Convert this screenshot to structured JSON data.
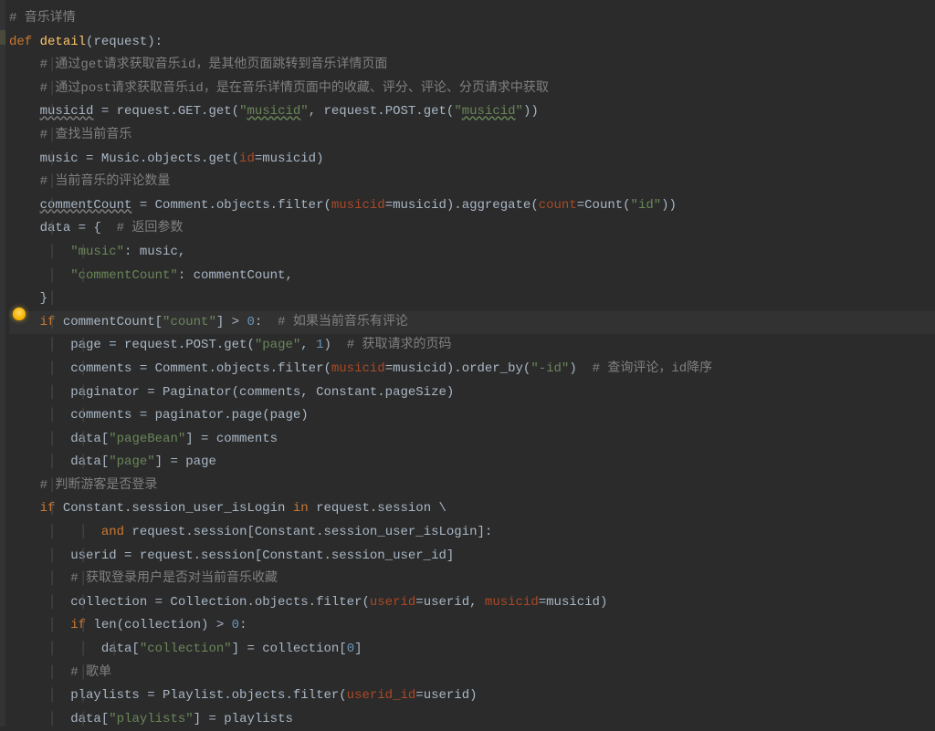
{
  "code": {
    "l1": {
      "hash": "#",
      "cm": " 音乐详情"
    },
    "l2": {
      "def": "def",
      "fn": "detail",
      "par": "(request):"
    },
    "l3": {
      "hash": "#",
      "cm": " 通过get请求获取音乐id，是其他页面跳转到音乐详情页面"
    },
    "l4": {
      "hash": "#",
      "cm": " 通过post请求获取音乐id，是在音乐详情页面中的收藏、评分、评论、分页请求中获取"
    },
    "l5": {
      "v": "musicid",
      "eq": " = request.GET.get(",
      "s1": "\"",
      "s1b": "musicid",
      "s1c": "\"",
      "c": ", request.POST.get(",
      "s2": "\"",
      "s2b": "musicid",
      "s2c": "\"",
      "end": "))"
    },
    "l6": {
      "hash": "#",
      "cm": " 查找当前音乐"
    },
    "l7": {
      "pre": "music = Music.objects.get(",
      "k": "id",
      "eq": "=musicid)"
    },
    "l8": {
      "hash": "#",
      "cm": " 当前音乐的评论数量"
    },
    "l9": {
      "v": "commentCount",
      "pre": " = Comment.objects.filter(",
      "k1": "musicid",
      "eq1": "=musicid).aggregate(",
      "k2": "count",
      "eq2": "=Count(",
      "s": "\"id\"",
      "end": "))"
    },
    "l10": {
      "pre": "data = {  ",
      "hash": "#",
      "cm": " 返回参数"
    },
    "l11": {
      "s": "\"music\"",
      "rest": ": music,"
    },
    "l12": {
      "s": "\"commentCount\"",
      "rest": ": commentCount,"
    },
    "l13": {
      "t": "}"
    },
    "l14": {
      "if": "if",
      "pre": " commentCount[",
      "s": "\"count\"",
      "mid": "] > ",
      "n": "0",
      "col": ":  ",
      "hash": "#",
      "cm": " 如果当前音乐有评论"
    },
    "l15": {
      "pre": "page = request.POST.get(",
      "s": "\"page\"",
      "c": ", ",
      "n": "1",
      "end": ")  ",
      "hash": "#",
      "cm": " 获取请求的页码"
    },
    "l16": {
      "pre": "comments = Comment.objects.filter(",
      "k": "musicid",
      "eq": "=musicid).order_by(",
      "s": "\"-id\"",
      "end": ")  ",
      "hash": "#",
      "cm": " 查询评论，id降序"
    },
    "l17": {
      "t": "paginator = Paginator(comments, Constant.pageSize)"
    },
    "l18": {
      "t": "comments = paginator.page(page)"
    },
    "l19": {
      "pre": "data[",
      "s": "\"pageBean\"",
      "end": "] = comments"
    },
    "l20": {
      "pre": "data[",
      "s": "\"page\"",
      "end": "] = page"
    },
    "l21": {
      "hash": "#",
      "cm": " 判断游客是否登录"
    },
    "l22": {
      "if": "if",
      "pre": " Constant.session_user_isLogin ",
      "in": "in",
      "end": " request.session \\"
    },
    "l23": {
      "and": "and",
      "end": " request.session[Constant.session_user_isLogin]:"
    },
    "l24": {
      "t": "userid = request.session[Constant.session_user_id]"
    },
    "l25": {
      "hash": "#",
      "cm": " 获取登录用户是否对当前音乐收藏"
    },
    "l26": {
      "pre": "collection = Collection.objects.filter(",
      "k1": "userid",
      "eq1": "=userid, ",
      "k2": "musicid",
      "eq2": "=musicid)"
    },
    "l27": {
      "if": "if",
      "pre": " len(collection) > ",
      "n": "0",
      "end": ":"
    },
    "l28": {
      "pre": "data[",
      "s": "\"collection\"",
      "mid": "] = collection[",
      "n": "0",
      "end": "]"
    },
    "l29": {
      "hash": "#",
      "cm": " 歌单"
    },
    "l30": {
      "pre": "playlists = Playlist.objects.filter(",
      "k": "userid_id",
      "eq": "=userid)"
    },
    "l31": {
      "pre": "data[",
      "s": "\"playlists\"",
      "end": "] = playlists"
    }
  }
}
